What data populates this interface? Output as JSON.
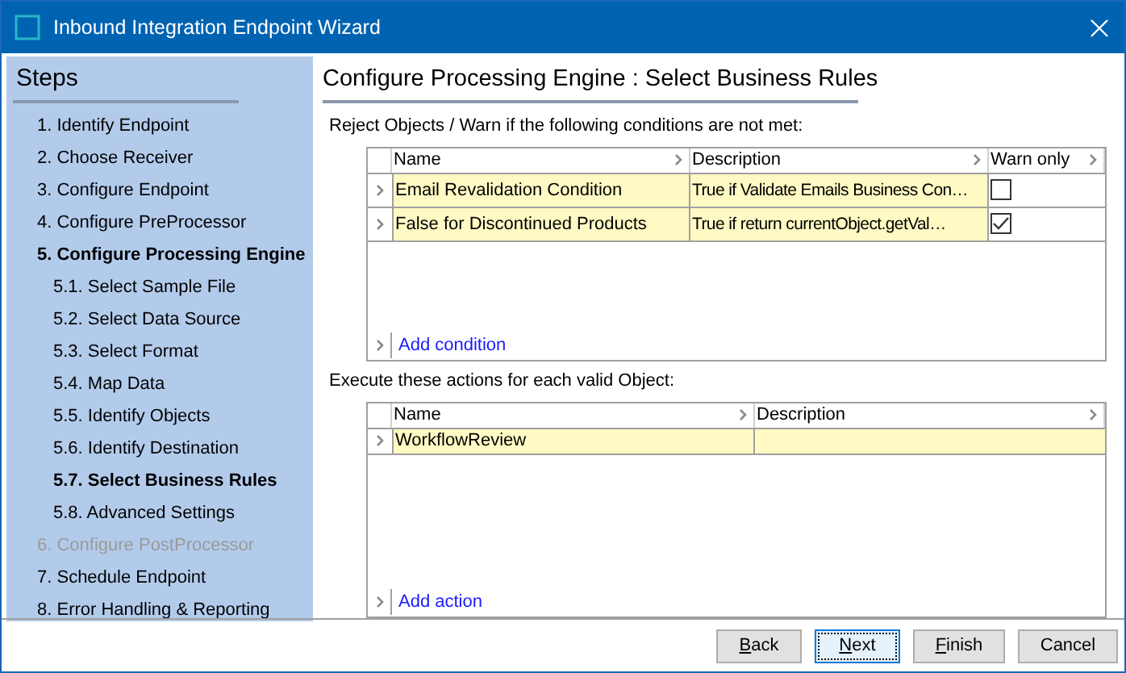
{
  "window": {
    "title": "Inbound Integration Endpoint Wizard"
  },
  "sidebar": {
    "title": "Steps",
    "items": [
      {
        "label": "1. Identify Endpoint",
        "selected": false,
        "disabled": false
      },
      {
        "label": "2. Choose Receiver",
        "selected": false,
        "disabled": false
      },
      {
        "label": "3. Configure Endpoint",
        "selected": false,
        "disabled": false
      },
      {
        "label": "4. Configure PreProcessor",
        "selected": false,
        "disabled": false
      },
      {
        "label": "5. Configure Processing Engine",
        "selected": true,
        "disabled": false,
        "children": [
          {
            "label": "5.1. Select Sample File",
            "selected": false,
            "disabled": false
          },
          {
            "label": "5.2. Select Data Source",
            "selected": false,
            "disabled": false
          },
          {
            "label": "5.3. Select Format",
            "selected": false,
            "disabled": false
          },
          {
            "label": "5.4. Map Data",
            "selected": false,
            "disabled": false
          },
          {
            "label": "5.5. Identify Objects",
            "selected": false,
            "disabled": false
          },
          {
            "label": "5.6. Identify Destination",
            "selected": false,
            "disabled": false
          },
          {
            "label": "5.7. Select Business Rules",
            "selected": true,
            "disabled": false
          },
          {
            "label": "5.8. Advanced Settings",
            "selected": false,
            "disabled": false
          }
        ]
      },
      {
        "label": "6. Configure PostProcessor",
        "selected": false,
        "disabled": true
      },
      {
        "label": "7. Schedule Endpoint",
        "selected": false,
        "disabled": false
      },
      {
        "label": "8. Error Handling & Reporting",
        "selected": false,
        "disabled": false
      }
    ]
  },
  "page": {
    "title": "Configure Processing Engine : Select Business Rules"
  },
  "conditions": {
    "caption": "Reject Objects / Warn if the following conditions are not met:",
    "columns": [
      "Name",
      "Description",
      "Warn only"
    ],
    "rows": [
      {
        "name": "Email Revalidation Condition",
        "description": "True if Validate Emails Business Con…",
        "checked": false
      },
      {
        "name": "False for Discontinued Products",
        "description": "True if return currentObject.getVal…",
        "checked": true
      }
    ],
    "add_link": "Add condition"
  },
  "actions": {
    "caption": "Execute these actions for each valid Object:",
    "columns": [
      "Name",
      "Description"
    ],
    "rows": [
      {
        "name": "WorkflowReview",
        "description": ""
      }
    ],
    "add_link": "Add action"
  },
  "buttons": [
    {
      "label": "Back",
      "mnemonic": true,
      "focused": false
    },
    {
      "label": "Next",
      "mnemonic": true,
      "focused": true
    },
    {
      "label": "Finish",
      "mnemonic": true,
      "focused": false
    },
    {
      "label": "Cancel",
      "mnemonic": false,
      "focused": false
    }
  ]
}
